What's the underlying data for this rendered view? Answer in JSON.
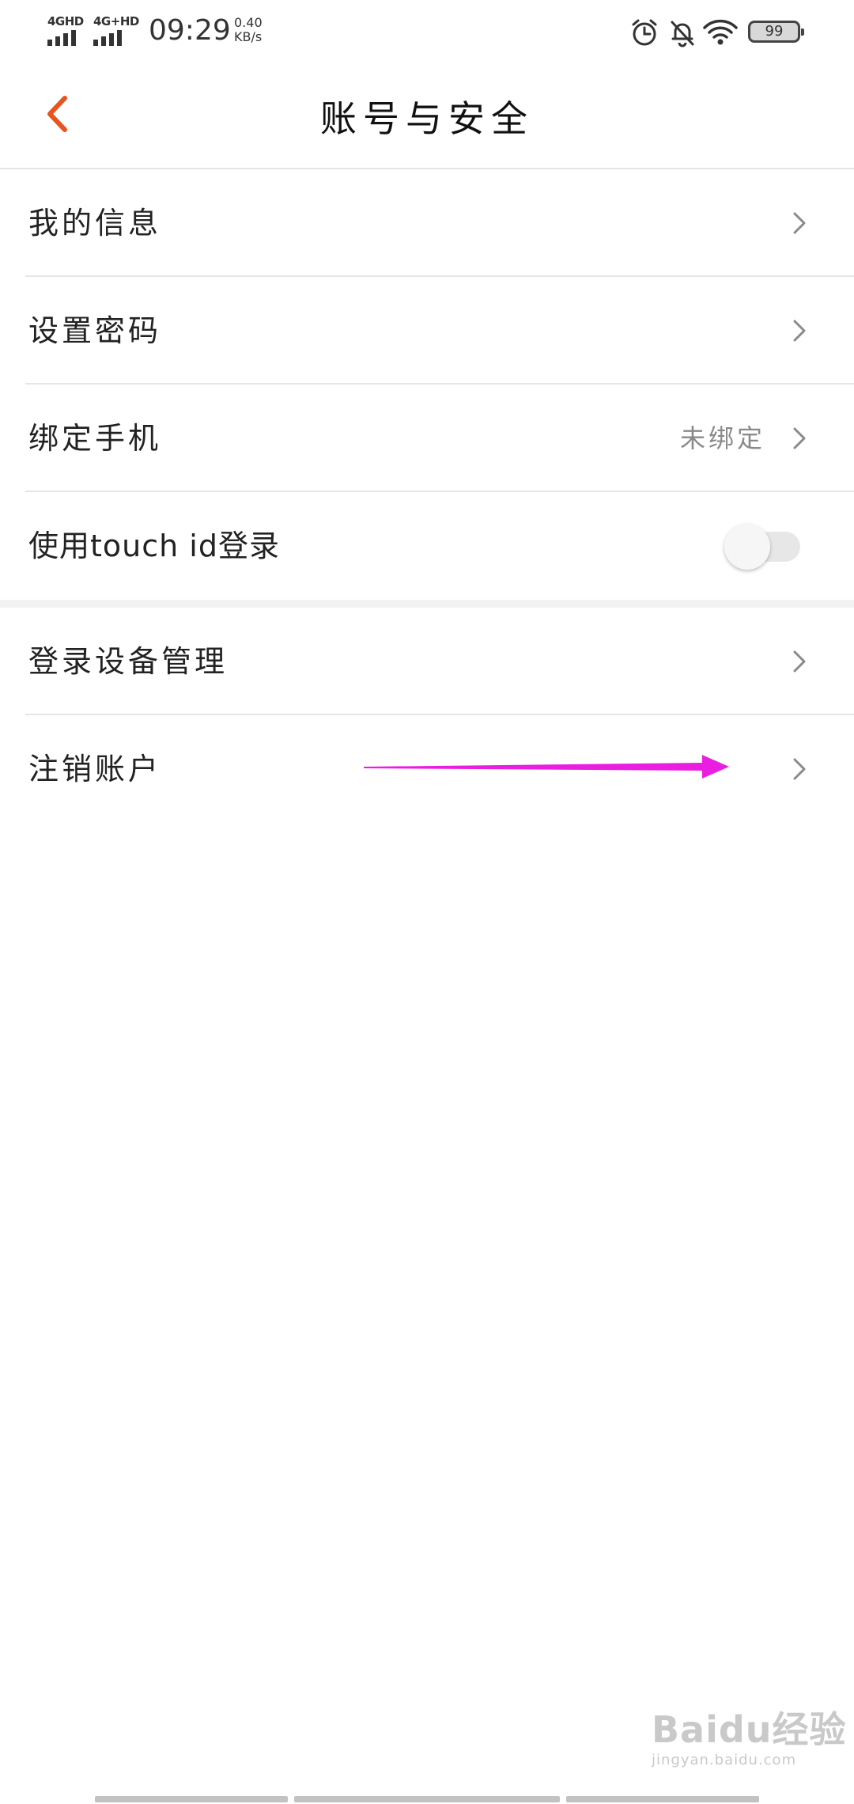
{
  "status_bar": {
    "signal1_label": "4GHD",
    "signal2_label": "4G+HD",
    "time": "09:29",
    "net_speed_value": "0.40",
    "net_speed_unit": "KB/s",
    "battery_level": "99",
    "icons": [
      "alarm-icon",
      "bell-muted-icon",
      "wifi-icon",
      "battery-icon"
    ]
  },
  "header": {
    "title": "账号与安全",
    "back_icon": "chevron-left-icon"
  },
  "settings": {
    "items": [
      {
        "label": "我的信息"
      },
      {
        "label": "设置密码"
      },
      {
        "label": "绑定手机",
        "value": "未绑定"
      },
      {
        "label": "使用touch id登录",
        "toggle_on": false
      },
      {
        "label": "登录设备管理"
      },
      {
        "label": "注销账户"
      }
    ]
  },
  "annotation": {
    "color": "#ea1ee0",
    "points_to": "注销账户"
  },
  "watermark": {
    "main": "Baidu经验",
    "sub": "jingyan.baidu.com"
  },
  "colors": {
    "accent": "#e8541e",
    "divider": "#e6e6e6",
    "chevron": "#8a8a8a",
    "secondary_text": "#8a8a8a"
  }
}
